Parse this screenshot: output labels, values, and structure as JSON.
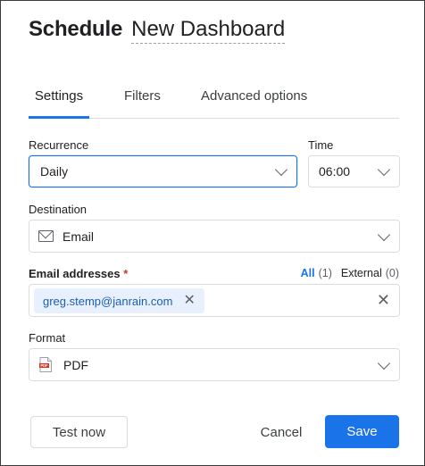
{
  "header": {
    "title_prefix": "Schedule",
    "title_name": "New Dashboard"
  },
  "tabs": [
    {
      "label": "Settings",
      "active": true
    },
    {
      "label": "Filters",
      "active": false
    },
    {
      "label": "Advanced options",
      "active": false
    }
  ],
  "recurrence": {
    "label": "Recurrence",
    "value": "Daily"
  },
  "time": {
    "label": "Time",
    "value": "06:00"
  },
  "destination": {
    "label": "Destination",
    "value": "Email",
    "icon": "mail-icon"
  },
  "email_addresses": {
    "label": "Email addresses",
    "required_marker": "*",
    "filter_all": "All",
    "filter_all_count": "(1)",
    "filter_external": "External",
    "filter_external_count": "(0)",
    "chips": [
      "greg.stemp@janrain.com"
    ],
    "chip_remove": "✕",
    "clear_all": "✕"
  },
  "format": {
    "label": "Format",
    "value": "PDF",
    "icon": "pdf-file-icon",
    "icon_text": "PDF"
  },
  "buttons": {
    "test_now": "Test now",
    "cancel": "Cancel",
    "save": "Save"
  },
  "colors": {
    "accent": "#1a73e8",
    "required": "#d93025",
    "chip_bg": "#e8f0fe",
    "pdf_red": "#d93025"
  }
}
